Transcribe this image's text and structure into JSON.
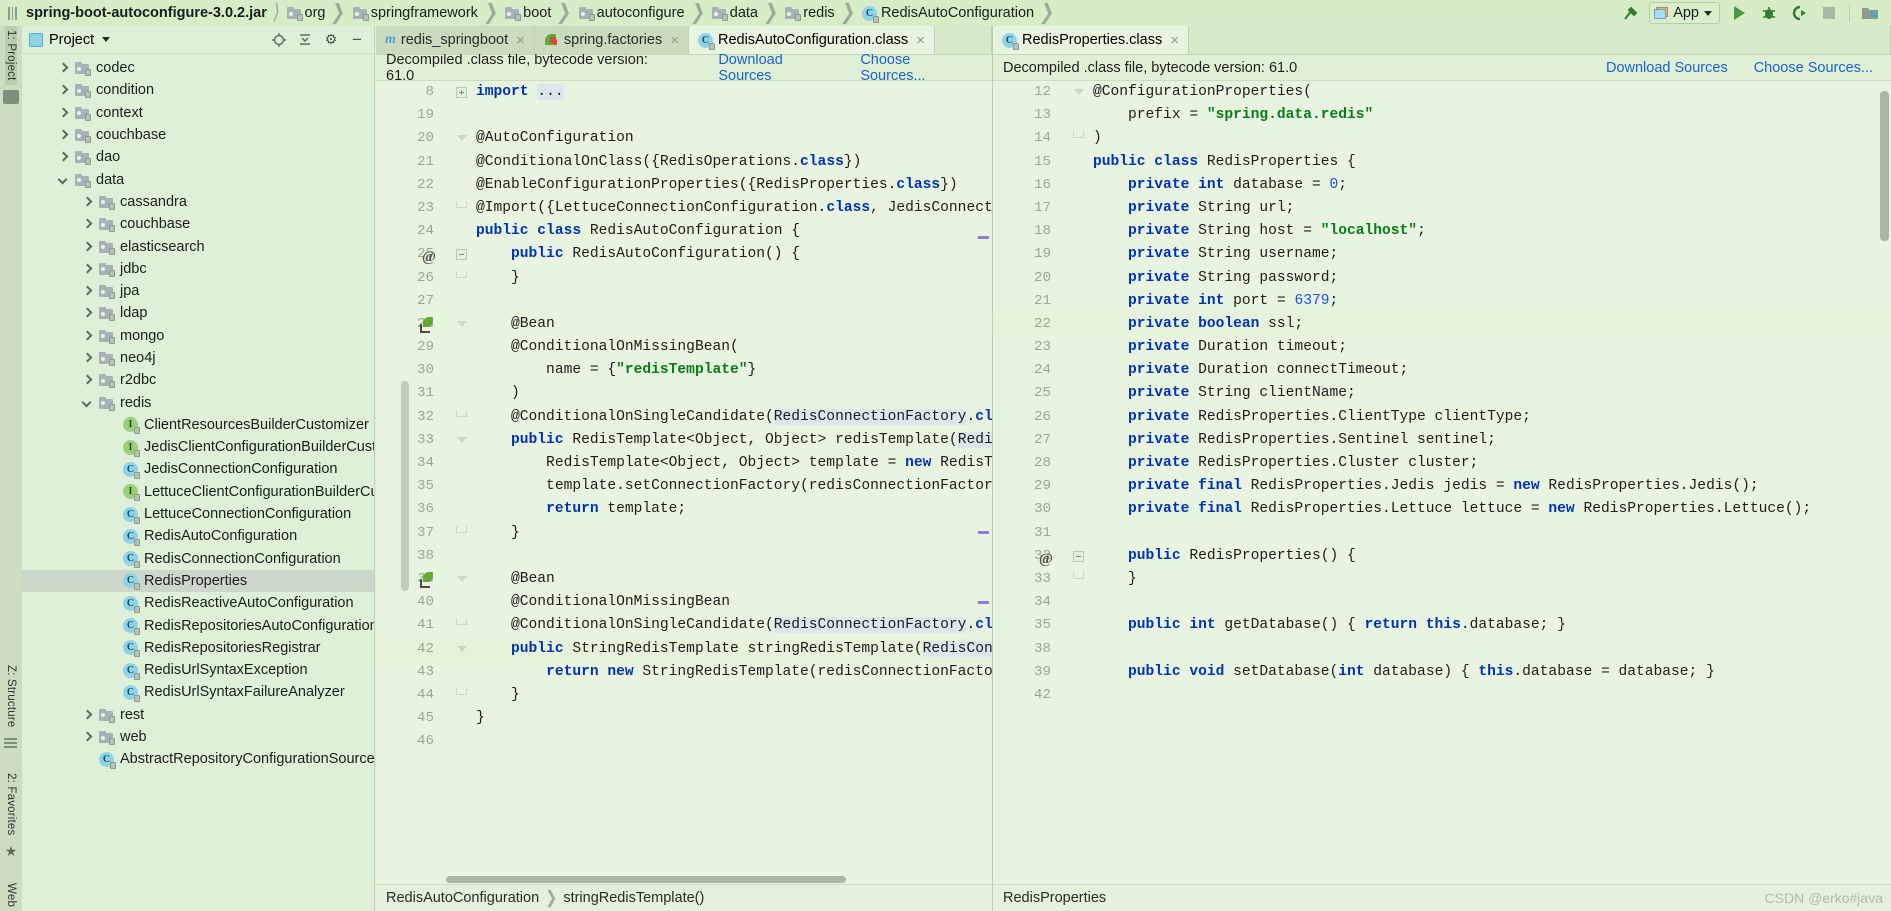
{
  "topbar": {
    "jar": "spring-boot-autoconfigure-3.0.2.jar",
    "crumbs": [
      {
        "label": "org",
        "icon": "folder-icon"
      },
      {
        "label": "springframework",
        "icon": "folder-icon"
      },
      {
        "label": "boot",
        "icon": "folder-icon"
      },
      {
        "label": "autoconfigure",
        "icon": "folder-icon"
      },
      {
        "label": "data",
        "icon": "folder-icon"
      },
      {
        "label": "redis",
        "icon": "folder-icon"
      },
      {
        "label": "RedisAutoConfiguration",
        "icon": "class-icon"
      }
    ],
    "run_config": "App",
    "actions": [
      "build-hammer-icon",
      "run-icon",
      "debug-icon",
      "run-with-coverage-icon",
      "stop-icon",
      "project-structure-icon"
    ]
  },
  "rail": {
    "top": "1: Project",
    "mid": "Z: Structure",
    "fav": "2: Favorites",
    "bottom": "Web"
  },
  "project_panel": {
    "title": "Project",
    "header_icons": [
      "locate-icon",
      "collapse-all-icon",
      "settings-gear-icon",
      "hide-icon"
    ],
    "tree": [
      {
        "label": "codec",
        "depth": 1,
        "twist": "r",
        "icon": "folder-icon",
        "sel": false
      },
      {
        "label": "condition",
        "depth": 1,
        "twist": "r",
        "icon": "folder-icon",
        "sel": false
      },
      {
        "label": "context",
        "depth": 1,
        "twist": "r",
        "icon": "folder-icon",
        "sel": false
      },
      {
        "label": "couchbase",
        "depth": 1,
        "twist": "r",
        "icon": "folder-icon",
        "sel": false
      },
      {
        "label": "dao",
        "depth": 1,
        "twist": "r",
        "icon": "folder-icon",
        "sel": false
      },
      {
        "label": "data",
        "depth": 1,
        "twist": "d",
        "icon": "folder-icon",
        "sel": false
      },
      {
        "label": "cassandra",
        "depth": 2,
        "twist": "r",
        "icon": "folder-icon",
        "sel": false
      },
      {
        "label": "couchbase",
        "depth": 2,
        "twist": "r",
        "icon": "folder-icon",
        "sel": false
      },
      {
        "label": "elasticsearch",
        "depth": 2,
        "twist": "r",
        "icon": "folder-icon",
        "sel": false
      },
      {
        "label": "jdbc",
        "depth": 2,
        "twist": "r",
        "icon": "folder-icon",
        "sel": false
      },
      {
        "label": "jpa",
        "depth": 2,
        "twist": "r",
        "icon": "folder-icon",
        "sel": false
      },
      {
        "label": "ldap",
        "depth": 2,
        "twist": "r",
        "icon": "folder-icon",
        "sel": false
      },
      {
        "label": "mongo",
        "depth": 2,
        "twist": "r",
        "icon": "folder-icon",
        "sel": false
      },
      {
        "label": "neo4j",
        "depth": 2,
        "twist": "r",
        "icon": "folder-icon",
        "sel": false
      },
      {
        "label": "r2dbc",
        "depth": 2,
        "twist": "r",
        "icon": "folder-icon",
        "sel": false
      },
      {
        "label": "redis",
        "depth": 2,
        "twist": "d",
        "icon": "folder-icon",
        "sel": false
      },
      {
        "label": "ClientResourcesBuilderCustomizer",
        "depth": 3,
        "twist": "none",
        "icon": "interface-icon",
        "sel": false
      },
      {
        "label": "JedisClientConfigurationBuilderCustomizer",
        "depth": 3,
        "twist": "none",
        "icon": "interface-icon",
        "sel": false
      },
      {
        "label": "JedisConnectionConfiguration",
        "depth": 3,
        "twist": "none",
        "icon": "class-icon",
        "sel": false
      },
      {
        "label": "LettuceClientConfigurationBuilderCustomizer",
        "depth": 3,
        "twist": "none",
        "icon": "interface-icon",
        "sel": false
      },
      {
        "label": "LettuceConnectionConfiguration",
        "depth": 3,
        "twist": "none",
        "icon": "class-icon",
        "sel": false
      },
      {
        "label": "RedisAutoConfiguration",
        "depth": 3,
        "twist": "none",
        "icon": "class-icon",
        "sel": false
      },
      {
        "label": "RedisConnectionConfiguration",
        "depth": 3,
        "twist": "none",
        "icon": "class-icon",
        "sel": false
      },
      {
        "label": "RedisProperties",
        "depth": 3,
        "twist": "none",
        "icon": "class-icon",
        "sel": true
      },
      {
        "label": "RedisReactiveAutoConfiguration",
        "depth": 3,
        "twist": "none",
        "icon": "class-icon",
        "sel": false
      },
      {
        "label": "RedisRepositoriesAutoConfiguration",
        "depth": 3,
        "twist": "none",
        "icon": "class-icon",
        "sel": false
      },
      {
        "label": "RedisRepositoriesRegistrar",
        "depth": 3,
        "twist": "none",
        "icon": "class-icon",
        "sel": false
      },
      {
        "label": "RedisUrlSyntaxException",
        "depth": 3,
        "twist": "none",
        "icon": "class-icon",
        "sel": false
      },
      {
        "label": "RedisUrlSyntaxFailureAnalyzer",
        "depth": 3,
        "twist": "none",
        "icon": "class-icon",
        "sel": false
      },
      {
        "label": "rest",
        "depth": 2,
        "twist": "r",
        "icon": "folder-icon",
        "sel": false
      },
      {
        "label": "web",
        "depth": 2,
        "twist": "r",
        "icon": "folder-icon",
        "sel": false
      },
      {
        "label": "AbstractRepositoryConfigurationSourceSupport",
        "depth": 2,
        "twist": "none",
        "icon": "class-icon",
        "sel": false
      }
    ]
  },
  "tabs_left": [
    {
      "label": "redis_springboot",
      "icon": "maven-module-icon",
      "active": false,
      "closable": true
    },
    {
      "label": "spring.factories",
      "icon": "spring-leaf-icon",
      "active": false,
      "closable": true
    },
    {
      "label": "RedisAutoConfiguration.class",
      "icon": "class-icon",
      "active": true,
      "closable": true
    }
  ],
  "tabs_right": [
    {
      "label": "RedisProperties.class",
      "icon": "class-icon",
      "active": true,
      "closable": true
    }
  ],
  "notify_left": {
    "message": "Decompiled .class file, bytecode version: 61.0",
    "download": "Download Sources",
    "choose": "Choose Sources..."
  },
  "notify_right": {
    "message": "Decompiled .class file, bytecode version: 61.0",
    "download": "Download Sources",
    "choose": "Choose Sources..."
  },
  "breadcrumb_left": [
    "RedisAutoConfiguration",
    "stringRedisTemplate()"
  ],
  "breadcrumb_right": [
    "RedisProperties"
  ],
  "code_left": [
    {
      "n": "8",
      "gutter": "plus",
      "html": "<span class=\"kw\">import</span> <span class=\"sel-tok\">...</span>"
    },
    {
      "n": "19",
      "gutter": "",
      "html": ""
    },
    {
      "n": "20",
      "gutter": "tri",
      "html": "@AutoConfiguration"
    },
    {
      "n": "21",
      "gutter": "",
      "html": "@ConditionalOnClass({RedisOperations.<span class=\"kw\">class</span>})"
    },
    {
      "n": "22",
      "gutter": "",
      "html": "@EnableConfigurationProperties({RedisProperties.<span class=\"kw\">class</span>})"
    },
    {
      "n": "23",
      "gutter": "bot",
      "html": "@Import({LettuceConnectionConfiguration.<span class=\"kw\">class</span>, JedisConnectionConfiguration.<span class=\"kw\">class</span>})"
    },
    {
      "n": "24",
      "gutter": "",
      "html": "<span class=\"kw\">public class</span> RedisAutoConfiguration {"
    },
    {
      "n": "25",
      "gutter": "minus",
      "at": true,
      "html": "    <span class=\"kw\">public</span> RedisAutoConfiguration() {"
    },
    {
      "n": "26",
      "gutter": "bot",
      "html": "    }"
    },
    {
      "n": "27",
      "gutter": "",
      "html": ""
    },
    {
      "n": "28",
      "gutter": "tri",
      "bean": true,
      "html": "    @Bean"
    },
    {
      "n": "29",
      "gutter": "",
      "html": "    @ConditionalOnMissingBean("
    },
    {
      "n": "30",
      "gutter": "",
      "html": "        name = {<span class=\"str\">\"redisTemplate\"</span>}"
    },
    {
      "n": "31",
      "gutter": "",
      "html": "    )"
    },
    {
      "n": "32",
      "gutter": "bot",
      "html": "    @ConditionalOnSingleCandidate(<span class=\"sel-tok\">RedisConnectionFactory</span>.<span class=\"kw\">class</span>)"
    },
    {
      "n": "33",
      "gutter": "tri",
      "html": "    <span class=\"kw\">public</span> RedisTemplate&lt;Object, Object&gt; redisTemplate(<span class=\"sel-tok\">RedisConnectionFactory</span> redisConnectionFactory) {"
    },
    {
      "n": "34",
      "gutter": "",
      "html": "        RedisTemplate&lt;Object, Object&gt; template = <span class=\"kw\">new</span> RedisTemplate();"
    },
    {
      "n": "35",
      "gutter": "",
      "html": "        template.setConnectionFactory(redisConnectionFactory);"
    },
    {
      "n": "36",
      "gutter": "",
      "html": "        <span class=\"kw\">return</span> template;"
    },
    {
      "n": "37",
      "gutter": "bot",
      "html": "    }"
    },
    {
      "n": "38",
      "gutter": "",
      "html": ""
    },
    {
      "n": "39",
      "gutter": "tri",
      "bean": true,
      "html": "    @Bean"
    },
    {
      "n": "40",
      "gutter": "",
      "html": "    @ConditionalOnMissingBean"
    },
    {
      "n": "41",
      "gutter": "bot",
      "html": "    @ConditionalOnSingleCandidate(<span class=\"sel-tok\">RedisConnectionFactory</span>.<span class=\"kw\">class</span>)"
    },
    {
      "n": "42",
      "gutter": "tri",
      "hl": true,
      "html": "    <span class=\"kw\">public</span> StringRedisTemplate stringRedisTemplate(<span class=\"sel-tok\">RedisConnectionFactory</span><span class=\"caret\"></span><span class=\"ident-hl\"> redisConnectionFactory</span>) {"
    },
    {
      "n": "43",
      "gutter": "",
      "html": "        <span class=\"kw\">return new</span> StringRedisTemplate(redisConnectionFactory);"
    },
    {
      "n": "44",
      "gutter": "bot",
      "html": "    }"
    },
    {
      "n": "45",
      "gutter": "",
      "html": "}"
    },
    {
      "n": "46",
      "gutter": "",
      "html": ""
    }
  ],
  "code_right": [
    {
      "n": "12",
      "gutter": "tri",
      "html": "@ConfigurationProperties("
    },
    {
      "n": "13",
      "gutter": "",
      "html": "    prefix = <span class=\"str\">\"spring.data.redis\"</span>"
    },
    {
      "n": "14",
      "gutter": "bot",
      "html": ")"
    },
    {
      "n": "15",
      "gutter": "",
      "html": "<span class=\"kw\">public class</span> RedisProperties {"
    },
    {
      "n": "16",
      "gutter": "",
      "html": "    <span class=\"kw\">private int</span> database = <span class=\"num\">0</span>;"
    },
    {
      "n": "17",
      "gutter": "",
      "html": "    <span class=\"kw\">private</span> String url;"
    },
    {
      "n": "18",
      "gutter": "",
      "html": "    <span class=\"kw\">private</span> String host = <span class=\"str\">\"localhost\"</span>;"
    },
    {
      "n": "19",
      "gutter": "",
      "html": "    <span class=\"kw\">private</span> String username;"
    },
    {
      "n": "20",
      "gutter": "",
      "html": "    <span class=\"kw\">private</span> String password;"
    },
    {
      "n": "21",
      "gutter": "",
      "html": "    <span class=\"kw\">private int</span> port = <span class=\"num\">6379</span>;"
    },
    {
      "n": "22",
      "gutter": "",
      "hl": true,
      "html": "    <span class=\"kw\">private boolean</span> ssl;"
    },
    {
      "n": "23",
      "gutter": "",
      "html": "    <span class=\"kw\">private</span> Duration timeout;"
    },
    {
      "n": "24",
      "gutter": "",
      "html": "    <span class=\"kw\">private</span> Duration connectTimeout;"
    },
    {
      "n": "25",
      "gutter": "",
      "html": "    <span class=\"kw\">private</span> String clientName;"
    },
    {
      "n": "26",
      "gutter": "",
      "html": "    <span class=\"kw\">private</span> RedisProperties.ClientType clientType;"
    },
    {
      "n": "27",
      "gutter": "",
      "html": "    <span class=\"kw\">private</span> RedisProperties.Sentinel sentinel;"
    },
    {
      "n": "28",
      "gutter": "",
      "html": "    <span class=\"kw\">private</span> RedisProperties.Cluster cluster;"
    },
    {
      "n": "29",
      "gutter": "",
      "html": "    <span class=\"kw\">private final</span> RedisProperties.Jedis jedis = <span class=\"kw\">new</span> RedisProperties.Jedis();"
    },
    {
      "n": "30",
      "gutter": "",
      "html": "    <span class=\"kw\">private final</span> RedisProperties.Lettuce lettuce = <span class=\"kw\">new</span> RedisProperties.Lettuce();"
    },
    {
      "n": "31",
      "gutter": "",
      "html": ""
    },
    {
      "n": "32",
      "gutter": "minus",
      "at": true,
      "html": "    <span class=\"kw\">public</span> RedisProperties() {"
    },
    {
      "n": "33",
      "gutter": "bot",
      "html": "    }"
    },
    {
      "n": "34",
      "gutter": "",
      "html": ""
    },
    {
      "n": "35",
      "gutter": "",
      "html": "    <span class=\"kw\">public int</span> getDatabase() { <span class=\"kw\">return this</span>.database; }"
    },
    {
      "n": "38",
      "gutter": "",
      "html": ""
    },
    {
      "n": "39",
      "gutter": "",
      "html": "    <span class=\"kw\">public void</span> setDatabase(<span class=\"kw\">int</span> database) { <span class=\"kw\">this</span>.database = database; }"
    },
    {
      "n": "42",
      "gutter": "",
      "html": ""
    }
  ],
  "watermark": "CSDN @erko#java"
}
